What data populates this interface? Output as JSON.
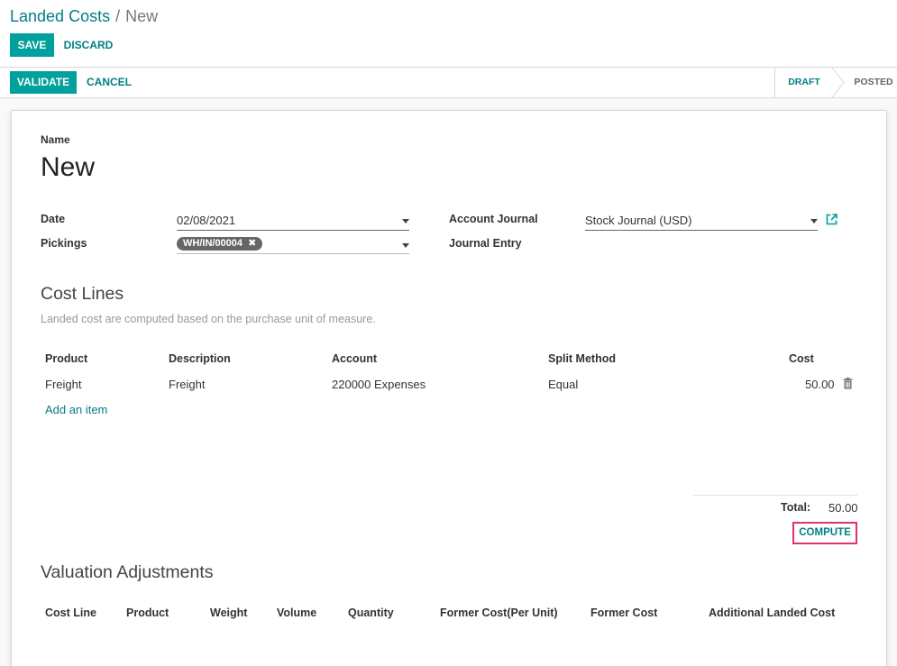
{
  "breadcrumb": {
    "parent": "Landed Costs",
    "separator": "/",
    "current": "New"
  },
  "control": {
    "save_label": "SAVE",
    "discard_label": "DISCARD"
  },
  "statusbar": {
    "validate_label": "VALIDATE",
    "cancel_label": "CANCEL",
    "stages": [
      "DRAFT",
      "POSTED"
    ],
    "active_stage": "DRAFT"
  },
  "form": {
    "name_label": "Name",
    "name_value": "New",
    "date_label": "Date",
    "date_value": "02/08/2021",
    "pickings_label": "Pickings",
    "pickings_tags": [
      "WH/IN/00004"
    ],
    "account_journal_label": "Account Journal",
    "account_journal_value": "Stock Journal (USD)",
    "journal_entry_label": "Journal Entry"
  },
  "cost_lines": {
    "title": "Cost Lines",
    "hint": "Landed cost are computed based on the purchase unit of measure.",
    "columns": [
      "Product",
      "Description",
      "Account",
      "Split Method",
      "Cost"
    ],
    "rows": [
      {
        "product": "Freight",
        "description": "Freight",
        "account": "220000 Expenses",
        "split_method": "Equal",
        "cost": "50.00"
      }
    ],
    "add_item": "Add an item",
    "total_label": "Total:",
    "total_value": "50.00",
    "compute_label": "COMPUTE"
  },
  "valuation": {
    "title": "Valuation Adjustments",
    "columns": [
      "Cost Line",
      "Product",
      "Weight",
      "Volume",
      "Quantity",
      "Former Cost(Per Unit)",
      "Former Cost",
      "Additional Landed Cost"
    ]
  },
  "colors": {
    "primary": "#00a09d",
    "link": "#017e84",
    "highlight": "#e0336e"
  },
  "icons": {
    "external_link": "external-link-icon",
    "delete": "trash-icon",
    "tag_remove": "close-icon"
  }
}
